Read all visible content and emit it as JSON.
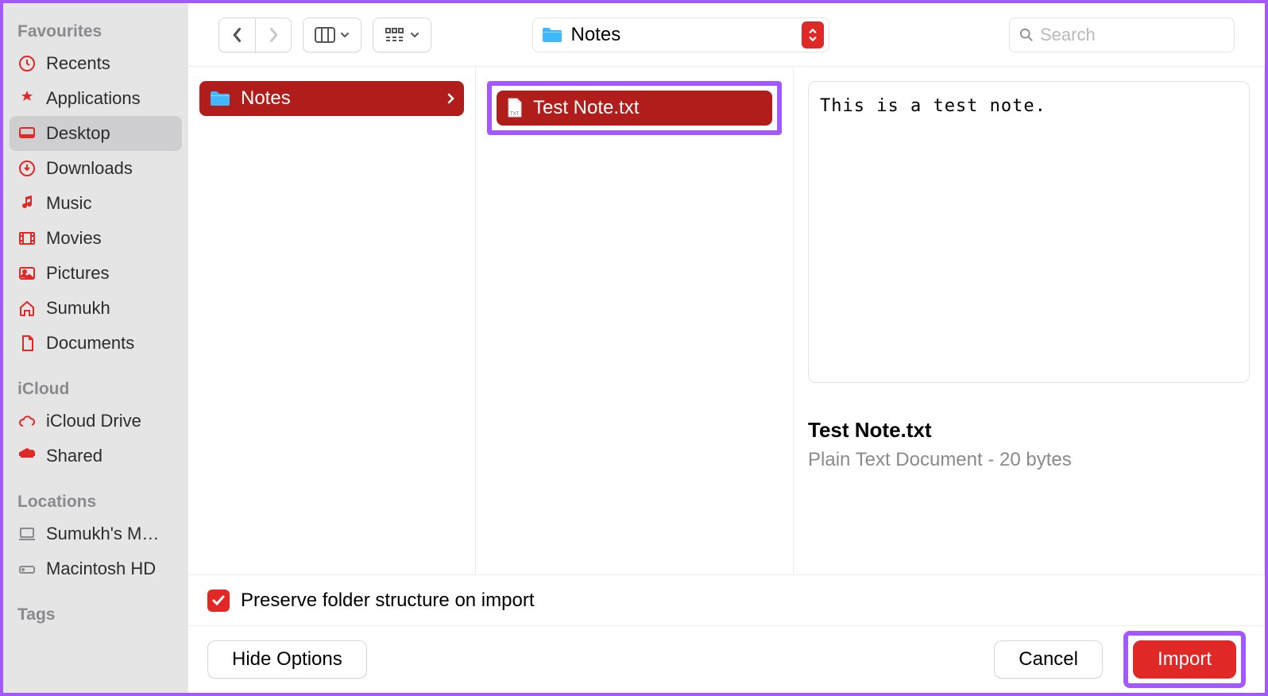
{
  "sidebar": {
    "sections": {
      "favourites_label": "Favourites",
      "icloud_label": "iCloud",
      "locations_label": "Locations",
      "tags_label": "Tags"
    },
    "favourites": [
      {
        "label": "Recents",
        "icon": "clock-icon"
      },
      {
        "label": "Applications",
        "icon": "apps-icon"
      },
      {
        "label": "Desktop",
        "icon": "desktop-icon",
        "selected": true
      },
      {
        "label": "Downloads",
        "icon": "download-icon"
      },
      {
        "label": "Music",
        "icon": "music-icon"
      },
      {
        "label": "Movies",
        "icon": "movies-icon"
      },
      {
        "label": "Pictures",
        "icon": "pictures-icon"
      },
      {
        "label": "Sumukh",
        "icon": "home-icon"
      },
      {
        "label": "Documents",
        "icon": "documents-icon"
      }
    ],
    "icloud": [
      {
        "label": "iCloud Drive",
        "icon": "cloud-icon"
      },
      {
        "label": "Shared",
        "icon": "shared-icon"
      }
    ],
    "locations": [
      {
        "label": "Sumukh's M…",
        "icon": "laptop-icon"
      },
      {
        "label": "Macintosh HD",
        "icon": "disk-icon"
      }
    ]
  },
  "toolbar": {
    "location": "Notes",
    "search_placeholder": "Search"
  },
  "columns": {
    "col1_item": "Notes",
    "col2_item": "Test Note.txt"
  },
  "preview": {
    "content": "This is a test note.",
    "file_name": "Test Note.txt",
    "file_meta": "Plain Text Document - 20 bytes"
  },
  "options": {
    "preserve_label": "Preserve folder structure on import",
    "preserve_checked": true
  },
  "buttons": {
    "hide_options": "Hide Options",
    "cancel": "Cancel",
    "import": "Import"
  },
  "colors": {
    "accent": "#e02926",
    "highlight": "#a259ff",
    "sidebar_bg": "#e5e5e5"
  }
}
